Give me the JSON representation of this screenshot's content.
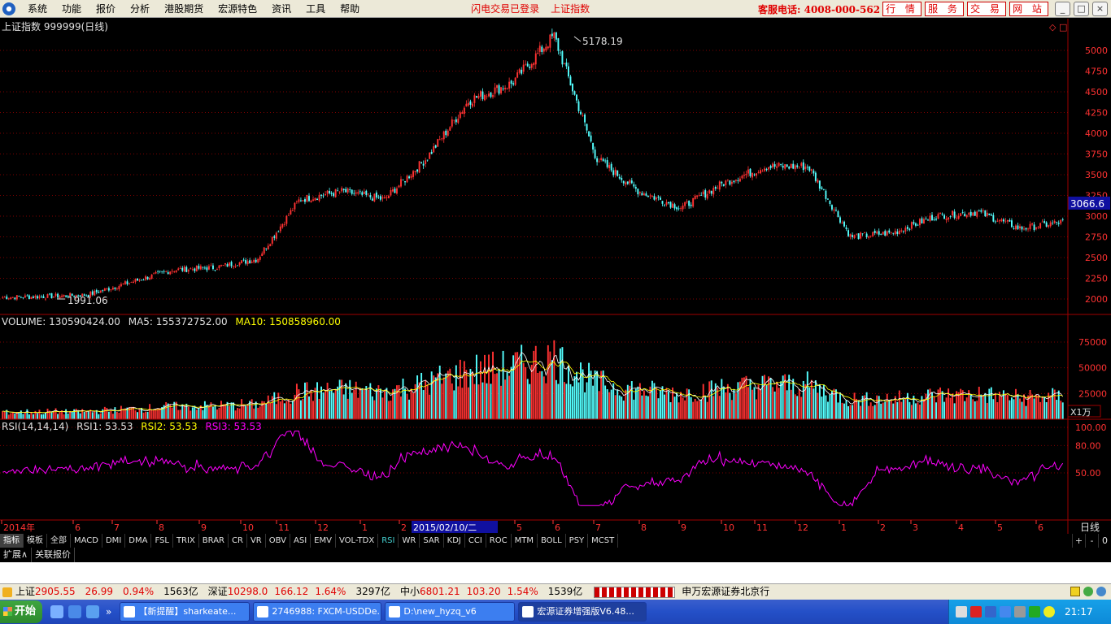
{
  "menubar": {
    "items": [
      "系统",
      "功能",
      "报价",
      "分析",
      "港股期货",
      "宏源特色",
      "资讯",
      "工具",
      "帮助"
    ],
    "status_login": "闪电交易已登录",
    "status_index": "上证指数",
    "hotline": "客服电话: 4008-000-562",
    "quick_buttons": [
      "行 情",
      "服 务",
      "交 易",
      "网 站"
    ],
    "window_buttons": [
      "_",
      "□",
      "×"
    ]
  },
  "chart": {
    "title": "上证指数  999999(日线)",
    "high_label": "5178.19",
    "low_label": "1991.06",
    "last_price_tag": "3066.6",
    "price_axis": [
      "5000",
      "4750",
      "4500",
      "4250",
      "4000",
      "3750",
      "3500",
      "3250",
      "3000",
      "2750",
      "2500",
      "2250",
      "2000"
    ],
    "volume_header": {
      "volume": "VOLUME: 130590424.00",
      "ma5": "MA5: 155372752.00",
      "ma10": "MA10: 150858960.00"
    },
    "volume_axis": [
      "75000",
      "50000",
      "25000"
    ],
    "volume_unit": "X1万",
    "rsi_header": {
      "name": "RSI(14,14,14)",
      "rsi1": "RSI1: 53.53",
      "rsi2": "RSI2: 53.53",
      "rsi3": "RSI3: 53.53"
    },
    "rsi_axis": [
      "100.00",
      "80.00",
      "50.00"
    ],
    "time_axis": [
      "2014年",
      "6",
      "7",
      "8",
      "9",
      "10",
      "11",
      "12",
      "1",
      "2",
      "2015/02/10/二",
      "5",
      "6",
      "7",
      "8",
      "9",
      "10",
      "11",
      "12",
      "1",
      "2",
      "3",
      "4",
      "5",
      "6"
    ],
    "period": "日线",
    "colors": {
      "up": "#ff3232",
      "down": "#54ffff",
      "ma_white": "#ffffff",
      "ma_yellow": "#ffff00",
      "rsi": "#ff00ff",
      "grid": "#800000"
    }
  },
  "chart_data": {
    "type": "line",
    "title": "上证指数 999999(日线)",
    "x": [
      "2014-05",
      "2014-06",
      "2014-07",
      "2014-08",
      "2014-09",
      "2014-10",
      "2014-11",
      "2014-12",
      "2015-01",
      "2015-02",
      "2015-03",
      "2015-04",
      "2015-05",
      "2015-06",
      "2015-07",
      "2015-08",
      "2015-09",
      "2015-10",
      "2015-11",
      "2015-12",
      "2016-01",
      "2016-02",
      "2016-03",
      "2016-04",
      "2016-05",
      "2016-06"
    ],
    "series": [
      {
        "name": "上证指数",
        "values": [
          2020,
          2030,
          2050,
          2200,
          2350,
          2380,
          2480,
          3200,
          3300,
          3200,
          3700,
          4400,
          4600,
          5178,
          3700,
          3300,
          3100,
          3400,
          3600,
          3600,
          2750,
          2800,
          3000,
          3050,
          2850,
          2930
        ]
      }
    ],
    "ylim": [
      1900,
      5300
    ]
  },
  "tabs": [
    "指标",
    "模板",
    "全部",
    "MACD",
    "DMI",
    "DMA",
    "FSL",
    "TRIX",
    "BRAR",
    "CR",
    "VR",
    "OBV",
    "ASI",
    "EMV",
    "VOL-TDX",
    "RSI",
    "WR",
    "SAR",
    "KDJ",
    "CCI",
    "ROC",
    "MTM",
    "BOLL",
    "PSY",
    "MCST"
  ],
  "tab_right": [
    "+",
    "-",
    "0"
  ],
  "ext_tabs": [
    "扩展∧",
    "关联报价"
  ],
  "quotes": {
    "sh_label": "上证",
    "sh_value": "2905.55",
    "sh_change": "26.99",
    "sh_pct": "0.94%",
    "sh_amount": "1563亿",
    "sz_label": "深证",
    "sz_value": "10298.0",
    "sz_change": "166.12",
    "sz_pct": "1.64%",
    "sz_amount": "3297亿",
    "zx_label": "中小",
    "zx_value": "6801.21",
    "zx_change": "103.20",
    "zx_pct": "1.54%",
    "zx_amount": "1539亿",
    "broker": "申万宏源证券北京行"
  },
  "taskbar": {
    "start": "开始",
    "tasks": [
      "【新提醒】sharkeate...",
      "2746988: FXCM-USDDe...",
      "D:\\new_hyzq_v6",
      "宏源证券增强版V6.48..."
    ],
    "clock": "21:17"
  }
}
